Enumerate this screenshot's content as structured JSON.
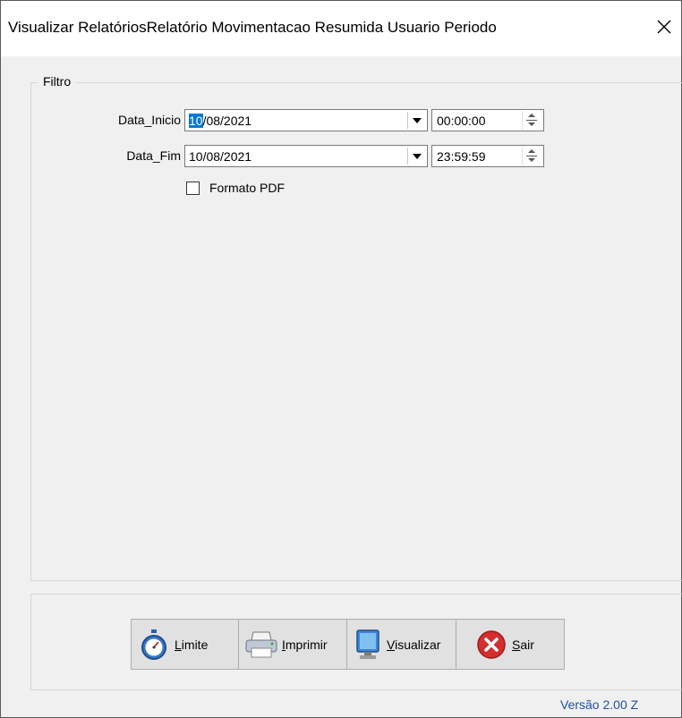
{
  "window": {
    "title": "Visualizar RelatóriosRelatório Movimentacao Resumida Usuario Periodo",
    "close_label": "×"
  },
  "filter": {
    "group_title": "Filtro",
    "start": {
      "label": "Data_Inicio",
      "date_selected": "10",
      "date_rest": "/08/2021",
      "time": "00:00:00"
    },
    "end": {
      "label": "Data_Fim",
      "date": "10/08/2021",
      "time": "23:59:59"
    },
    "pdf_checkbox": {
      "label": "Formato PDF",
      "checked": false
    }
  },
  "buttons": {
    "limite": {
      "mnemonic": "L",
      "rest": "imite",
      "icon": "stopwatch-icon"
    },
    "imprimir": {
      "mnemonic": "I",
      "rest": "mprimir",
      "icon": "printer-icon"
    },
    "visualizar": {
      "mnemonic": "V",
      "rest": "isualizar",
      "icon": "monitor-icon"
    },
    "sair": {
      "mnemonic": "S",
      "rest": "air",
      "icon": "exit-icon"
    }
  },
  "footer": {
    "version": "Versão 2.00 Z"
  },
  "colors": {
    "selection": "#0078d7",
    "version_text": "#1f4faa",
    "exit_red": "#d32f2f"
  }
}
